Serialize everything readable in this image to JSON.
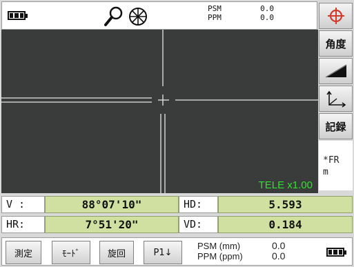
{
  "status_bar": {
    "battery_icon": "battery-full-icon",
    "icons": [
      "magnifier-icon",
      "laser-target-icon"
    ],
    "psm_label": "PSM",
    "psm_value": "0.0",
    "ppm_label": "PPM",
    "ppm_value": "0.0"
  },
  "view": {
    "zoom_label": "TELE x1.00",
    "zoom_color": "#2fe22f"
  },
  "side_keys": [
    {
      "icon": "crosshair-target-icon",
      "label": ""
    },
    {
      "icon": "",
      "label": "角度"
    },
    {
      "icon": "slope-distance-icon",
      "label": ""
    },
    {
      "icon": "coordinate-axes-icon",
      "label": ""
    },
    {
      "icon": "",
      "label": "記録"
    }
  ],
  "side_note": {
    "line1": "*FR",
    "line2": "m"
  },
  "measurements": {
    "v_label": "V  :",
    "v_value": "88°07'10\"",
    "hr_label": "HR:",
    "hr_value": "7°51'20\"",
    "hd_label": "HD:",
    "hd_value": "5.593",
    "vd_label": "VD:",
    "vd_value": "0.184",
    "value_bg": "#cfe0a0"
  },
  "function_keys": [
    {
      "label": "測定"
    },
    {
      "label": "ﾓｰﾄﾞ"
    },
    {
      "label": "旋回"
    },
    {
      "label": "P1↓"
    }
  ],
  "bottom_status": {
    "psm_label": "PSM (mm)",
    "psm_value": "0.0",
    "ppm_label": "PPM (ppm)",
    "ppm_value": "0.0",
    "battery_icon": "battery-full-icon"
  }
}
